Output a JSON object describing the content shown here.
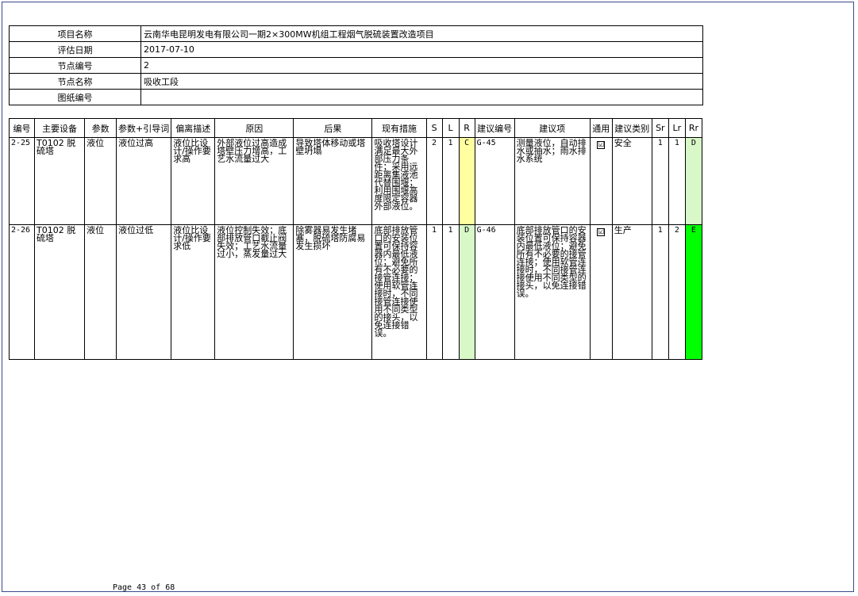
{
  "info": [
    {
      "label": "项目名称",
      "value": "云南华电昆明发电有限公司一期2×300MW机组工程烟气脱硫装置改造项目"
    },
    {
      "label": "评估日期",
      "value": "2017-07-10"
    },
    {
      "label": "节点编号",
      "value": "2"
    },
    {
      "label": "节点名称",
      "value": "吸收工段"
    },
    {
      "label": "图纸编号",
      "value": ""
    }
  ],
  "headers": [
    "编号",
    "主要设备",
    "参数",
    "参数+引导词",
    "偏离描述",
    "原因",
    "后果",
    "现有措施",
    "S",
    "L",
    "R",
    "建议编号",
    "建议项",
    "通用",
    "建议类别",
    "Sr",
    "Lr",
    "Rr"
  ],
  "rows": [
    {
      "id": "2-25",
      "equipment": "T0102 脱硫塔",
      "param": "液位",
      "guideword": "液位过高",
      "deviation": "液位比设计/操作要求高",
      "cause": "外部液位过高造成塔壁压力增高，工艺水流量过大",
      "consequence": "导致塔体移动或塔壁坍塌",
      "measures": "吸收塔设计满足最大外部压力条件；采用远距离集液池代替围堰；利用围堰高度限定容器外部液位。",
      "S": "2",
      "L": "1",
      "R": "C",
      "rec_id": "G-45",
      "recommendation": "测量液位，自动排水或抽水；雨水排水系统",
      "general": "☑",
      "category": "安全",
      "Sr": "1",
      "Lr": "1",
      "Rr": "D",
      "r_color": "#ffffa0",
      "rr_color": "#d8f8c8"
    },
    {
      "id": "2-26",
      "equipment": "T0102 脱硫塔",
      "param": "液位",
      "guideword": "液位过低",
      "deviation": "液位比设计/操作要求低",
      "cause": "液位控制失效；底部排放管口截止阀失效；工艺水流量过小，蒸发量过大",
      "consequence": "除雾器易发生堵塞，脱硫塔防腐易发生损坏",
      "measures": "底部排放管口的安装位置可保持容器内最低液位；避免所有不必要的接管连接；使用软管连接时，不同接管连接使用不同类型的接头，以免连接错误。",
      "S": "1",
      "L": "1",
      "R": "D",
      "rec_id": "G-46",
      "recommendation": "底部排放管口的安装位置可保持容器内最低液位；避免所有不必要的接管连接；使用软管连接时，不同接管连接使用不同类型的接头，以免连接错误。",
      "general": "☑",
      "category": "生产",
      "Sr": "1",
      "Lr": "2",
      "Rr": "E",
      "r_color": "#d8f8c8",
      "rr_color": "#00ff00"
    }
  ],
  "footer": "Page 43 of 68"
}
